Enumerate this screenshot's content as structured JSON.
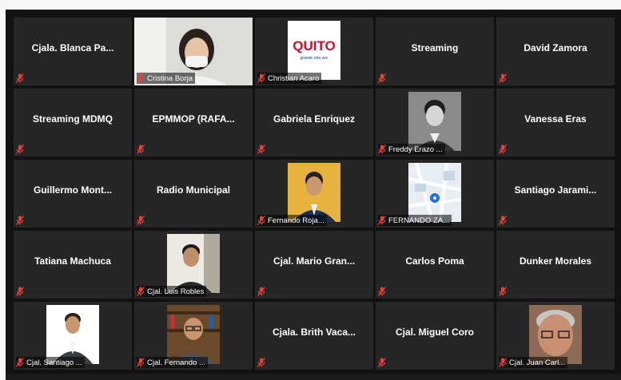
{
  "participants": [
    {
      "name": "Cjala. Blanca Pa...",
      "video": false
    },
    {
      "name": "Cristina Borja",
      "video": true,
      "photo": "woman-with-mask"
    },
    {
      "name": "Christian Acaro",
      "video": true,
      "photo": "quito-logo",
      "logo_text": "QUITO",
      "logo_sub": "grande otra vez"
    },
    {
      "name": "Streaming",
      "video": false
    },
    {
      "name": "David Zamora",
      "video": false
    },
    {
      "name": "Streaming MDMQ",
      "video": false
    },
    {
      "name": "EPMMOP (RAFA...",
      "video": false
    },
    {
      "name": "Gabriela Enriquez",
      "video": false
    },
    {
      "name": "Freddy Erazo ...",
      "video": true,
      "photo": "man-portrait-bw"
    },
    {
      "name": "Vanessa Eras",
      "video": false
    },
    {
      "name": "Guillermo Mont...",
      "video": false
    },
    {
      "name": "Radio Municipal",
      "video": false
    },
    {
      "name": "Fernando Roja...",
      "video": true,
      "photo": "man-suit-yellow-bg"
    },
    {
      "name": "FERNANDO ZA...",
      "video": true,
      "photo": "map"
    },
    {
      "name": "Santiago Jarami...",
      "video": false
    },
    {
      "name": "Tatiana Machuca",
      "video": false
    },
    {
      "name": "Cjal. Luis Robles",
      "video": true,
      "photo": "man-portrait-office"
    },
    {
      "name": "Cjal. Mario Gran...",
      "video": false
    },
    {
      "name": "Carlos Poma",
      "video": false
    },
    {
      "name": "Dunker Morales",
      "video": false
    },
    {
      "name": "Cjal. Santiago ...",
      "video": true,
      "photo": "man-suit-white-bg"
    },
    {
      "name": "Cjal. Fernando ...",
      "video": true,
      "photo": "man-glasses-bookshelf"
    },
    {
      "name": "Cjala. Brith Vaca...",
      "video": false
    },
    {
      "name": "Cjal. Miguel Coro",
      "video": false
    },
    {
      "name": "Cjal. Juan Carl...",
      "video": true,
      "photo": "older-man-closeup"
    }
  ],
  "colors": {
    "background": "#121212",
    "tile": "#262626",
    "muted_mic": "#e8423f",
    "name_text": "#ffffff"
  },
  "icons": {
    "mic": "muted-microphone-icon"
  }
}
